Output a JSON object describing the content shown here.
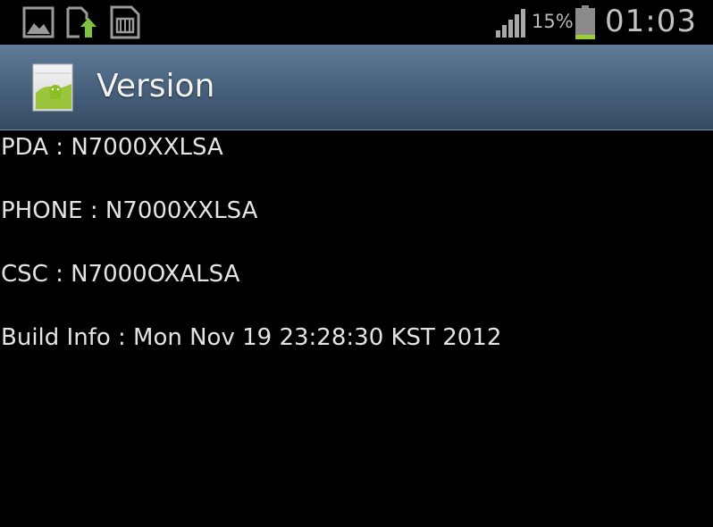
{
  "status_bar": {
    "icons": [
      "gallery-icon",
      "upload-icon",
      "sd-card-icon"
    ],
    "battery_percent": "15%",
    "battery_level": 0.15,
    "time": "01:03"
  },
  "title_bar": {
    "app_icon": "android-app-icon",
    "title": "Version"
  },
  "info": [
    {
      "label": "PDA",
      "value": "N7000XXLSA",
      "text": "PDA : N7000XXLSA"
    },
    {
      "label": "PHONE",
      "value": "N7000XXLSA",
      "text": "PHONE : N7000XXLSA"
    },
    {
      "label": "CSC",
      "value": "N7000OXALSA",
      "text": "CSC : N7000OXALSA"
    },
    {
      "label": "Build Info",
      "value": "Mon Nov 19 23:28:30 KST 2012",
      "text": "Build Info : Mon Nov 19 23:28:30 KST 2012"
    }
  ],
  "colors": {
    "title_bar_top": "#5f7c99",
    "title_bar_bottom": "#344a61",
    "battery_green": "#9acd32",
    "text": "#e4e4e4"
  }
}
